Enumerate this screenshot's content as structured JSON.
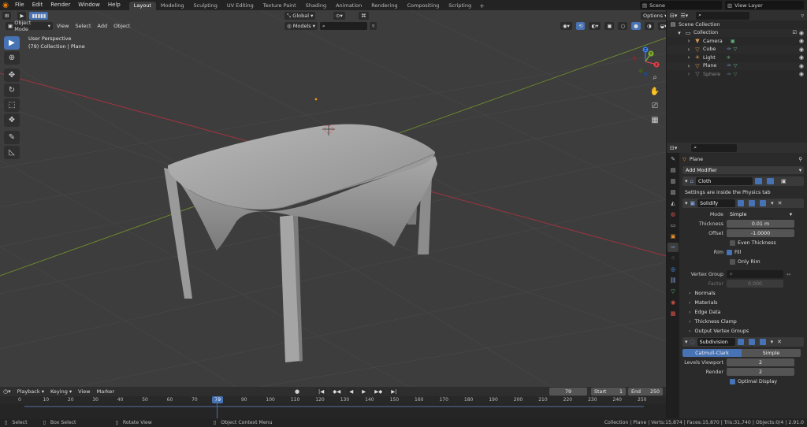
{
  "menubar": {
    "items": [
      "File",
      "Edit",
      "Render",
      "Window",
      "Help"
    ],
    "workspaces": [
      "Layout",
      "Modeling",
      "Sculpting",
      "UV Editing",
      "Texture Paint",
      "Shading",
      "Animation",
      "Rendering",
      "Compositing",
      "Scripting"
    ],
    "active_workspace": "Layout",
    "scene": "Scene",
    "view_layer": "View Layer"
  },
  "viewport": {
    "mode": "Object Mode",
    "menus": [
      "View",
      "Select",
      "Add",
      "Object"
    ],
    "transform_orientation": "Global",
    "options": "Options",
    "models_filter": "Models",
    "perspective_label": "User Perspective",
    "collection_label": "(79) Collection | Plane",
    "gizmo": {
      "x": "X",
      "y": "Y",
      "z": "Z"
    }
  },
  "outliner": {
    "root": "Scene Collection",
    "collection": "Collection",
    "items": [
      {
        "name": "Camera",
        "icon": "camera-icon",
        "color": "#d79b53"
      },
      {
        "name": "Cube",
        "icon": "mesh-icon",
        "color": "#d79b53"
      },
      {
        "name": "Light",
        "icon": "light-icon",
        "color": "#d79b53"
      },
      {
        "name": "Plane",
        "icon": "mesh-icon",
        "color": "#d79b53"
      },
      {
        "name": "Sphere",
        "icon": "mesh-icon",
        "color": "#888888"
      }
    ]
  },
  "properties": {
    "object_name": "Plane",
    "add_modifier": "Add Modifier",
    "cloth": {
      "name": "Cloth",
      "note": "Settings are inside the Physics tab"
    },
    "solidify": {
      "name": "Solidify",
      "mode_label": "Mode",
      "mode_value": "Simple",
      "thickness_label": "Thickness",
      "thickness_value": "0.01 m",
      "offset_label": "Offset",
      "offset_value": "-1.0000",
      "even_thickness": "Even Thickness",
      "rim_label": "Rim",
      "fill": "Fill",
      "only_rim": "Only Rim",
      "vertex_group_label": "Vertex Group",
      "factor_label": "Factor",
      "factor_value": "0.000",
      "subpanels": [
        "Normals",
        "Materials",
        "Edge Data",
        "Thickness Clamp",
        "Output Vertex Groups"
      ]
    },
    "subdivision": {
      "name": "Subdivision",
      "catmull": "Catmull-Clark",
      "simple": "Simple",
      "levels_viewport_label": "Levels Viewport",
      "levels_viewport_value": "2",
      "render_label": "Render",
      "render_value": "2",
      "optimal_display": "Optimal Display"
    }
  },
  "timeline": {
    "menus": [
      "Playback",
      "Keying",
      "View",
      "Marker"
    ],
    "current_frame": "79",
    "start_label": "Start",
    "start_value": "1",
    "end_label": "End",
    "end_value": "250",
    "ticks": [
      "0",
      "10",
      "20",
      "30",
      "40",
      "50",
      "60",
      "70",
      "80",
      "90",
      "100",
      "110",
      "120",
      "130",
      "140",
      "150",
      "160",
      "170",
      "180",
      "190",
      "200",
      "210",
      "220",
      "230",
      "240",
      "250"
    ]
  },
  "statusbar": {
    "select": "Select",
    "box_select": "Box Select",
    "rotate_view": "Rotate View",
    "context_menu": "Object Context Menu",
    "stats": "Collection | Plane | Verts:15,874 | Faces:15,870 | Tris:31,740 | Objects:0/4 | 2.91.0"
  }
}
